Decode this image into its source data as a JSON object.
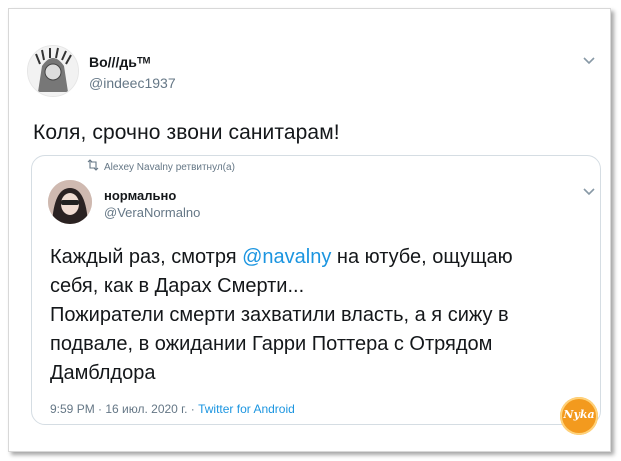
{
  "tweet": {
    "author_name": "Во///дьᵀᴹ",
    "author_handle": "@indeec1937",
    "text": "Коля, срочно звони санитарам!"
  },
  "quoted": {
    "retweet_line": "Alexey Navalny ретвитнул(а)",
    "author_name": "нормально",
    "author_handle": "@VeraNormalno",
    "line1_pre": "Каждый раз, смотря ",
    "mention": "@navalny",
    "line1_post": " на ютубе, ощущаю",
    "line2": "себя, как в Дарах Смерти...",
    "line3": "Пожиратели смерти захватили власть, а я сижу в",
    "line4": "подвале, в ожидании Гарри Поттера с Отрядом",
    "line5": "Дамблдора",
    "timestamp": "9:59 PM · 16 июл. 2020 г. · ",
    "source": "Twitter for Android"
  },
  "watermark": {
    "text": "Nyka",
    "color": "#f39a1e"
  },
  "icons": [
    "chevron-down-icon",
    "retweet-icon",
    "avatar",
    "watermark-logo"
  ],
  "colors": {
    "text": "#14171a",
    "secondary": "#657786",
    "link": "#1b95e0",
    "border": "#d5dde3"
  }
}
